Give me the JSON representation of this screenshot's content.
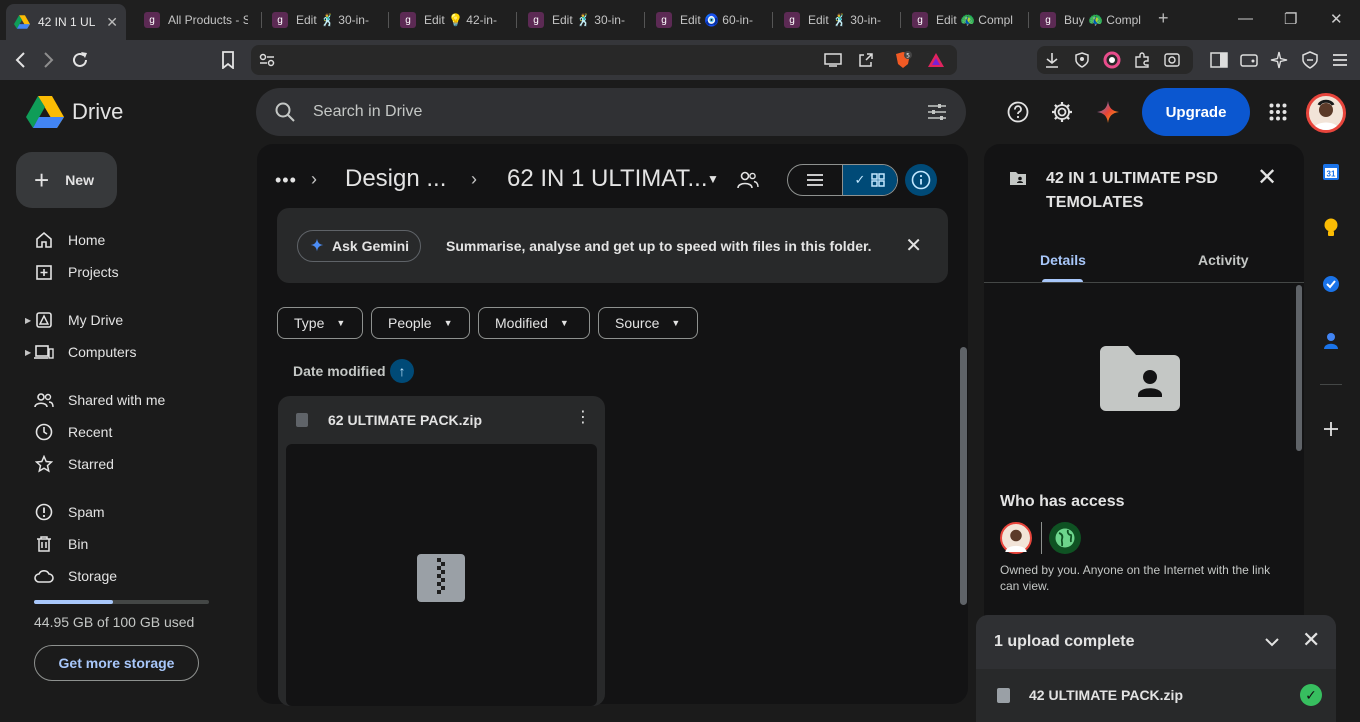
{
  "browser": {
    "tabs": [
      {
        "title": "42 IN 1 UL",
        "favicon": "google-drive-icon",
        "active": true
      },
      {
        "title": "All Products - S",
        "favicon": "gumroad-icon"
      },
      {
        "title": "Edit 🕺 30-in-",
        "favicon": "gumroad-icon"
      },
      {
        "title": "Edit 💡 42-in-",
        "favicon": "gumroad-icon"
      },
      {
        "title": "Edit 🕺 30-in-",
        "favicon": "gumroad-icon"
      },
      {
        "title": "Edit 🧿 60-in-",
        "favicon": "gumroad-icon"
      },
      {
        "title": "Edit 🕺 30-in-",
        "favicon": "gumroad-icon"
      },
      {
        "title": "Edit 🦚 Compl",
        "favicon": "gumroad-icon"
      },
      {
        "title": "Buy 🦚 Compl",
        "favicon": "gumroad-icon"
      }
    ],
    "new_tab": "+",
    "brave_badge": "5"
  },
  "drive": {
    "app_name": "Drive",
    "search_placeholder": "Search in Drive",
    "upgrade_label": "Upgrade",
    "new_label": "New",
    "sidebar": [
      {
        "label": "Home",
        "icon": "home-icon"
      },
      {
        "label": "Projects",
        "icon": "projects-icon"
      },
      {
        "label": "My Drive",
        "icon": "my-drive-icon",
        "expandable": true
      },
      {
        "label": "Computers",
        "icon": "computers-icon",
        "expandable": true
      },
      {
        "label": "Shared with me",
        "icon": "shared-icon"
      },
      {
        "label": "Recent",
        "icon": "clock-icon"
      },
      {
        "label": "Starred",
        "icon": "star-icon"
      },
      {
        "label": "Spam",
        "icon": "spam-icon"
      },
      {
        "label": "Bin",
        "icon": "bin-icon"
      },
      {
        "label": "Storage",
        "icon": "cloud-icon"
      }
    ],
    "storage": {
      "used_text": "44.95 GB of 100 GB used",
      "used_fraction": 0.4495,
      "cta": "Get more storage"
    }
  },
  "main": {
    "breadcrumb": {
      "overflow": "•••",
      "parent": "Design ...",
      "current": "62 IN 1 ULTIMAT..."
    },
    "gemini": {
      "button": "Ask Gemini",
      "message": "Summarise, analyse and get up to speed with files in this folder."
    },
    "filters": [
      "Type",
      "People",
      "Modified",
      "Source"
    ],
    "sort": {
      "label": "Date modified",
      "direction": "ascending"
    },
    "files": [
      {
        "name": "62 ULTIMATE PACK.zip",
        "type": "zip"
      }
    ]
  },
  "details": {
    "title": "42 IN 1 ULTIMATE PSD TEMOLATES",
    "tabs": [
      "Details",
      "Activity"
    ],
    "active_tab": "Details",
    "who_has_access": "Who has access",
    "access_text": "Owned by you. Anyone on the Internet with the link can view."
  },
  "upload": {
    "title": "1 upload complete",
    "file": "42 ULTIMATE PACK.zip",
    "status": "complete"
  },
  "colors": {
    "accent": "#a8c7fa",
    "upgrade": "#0b57d0",
    "success": "#37be5f",
    "background": "#1b1b1b"
  }
}
